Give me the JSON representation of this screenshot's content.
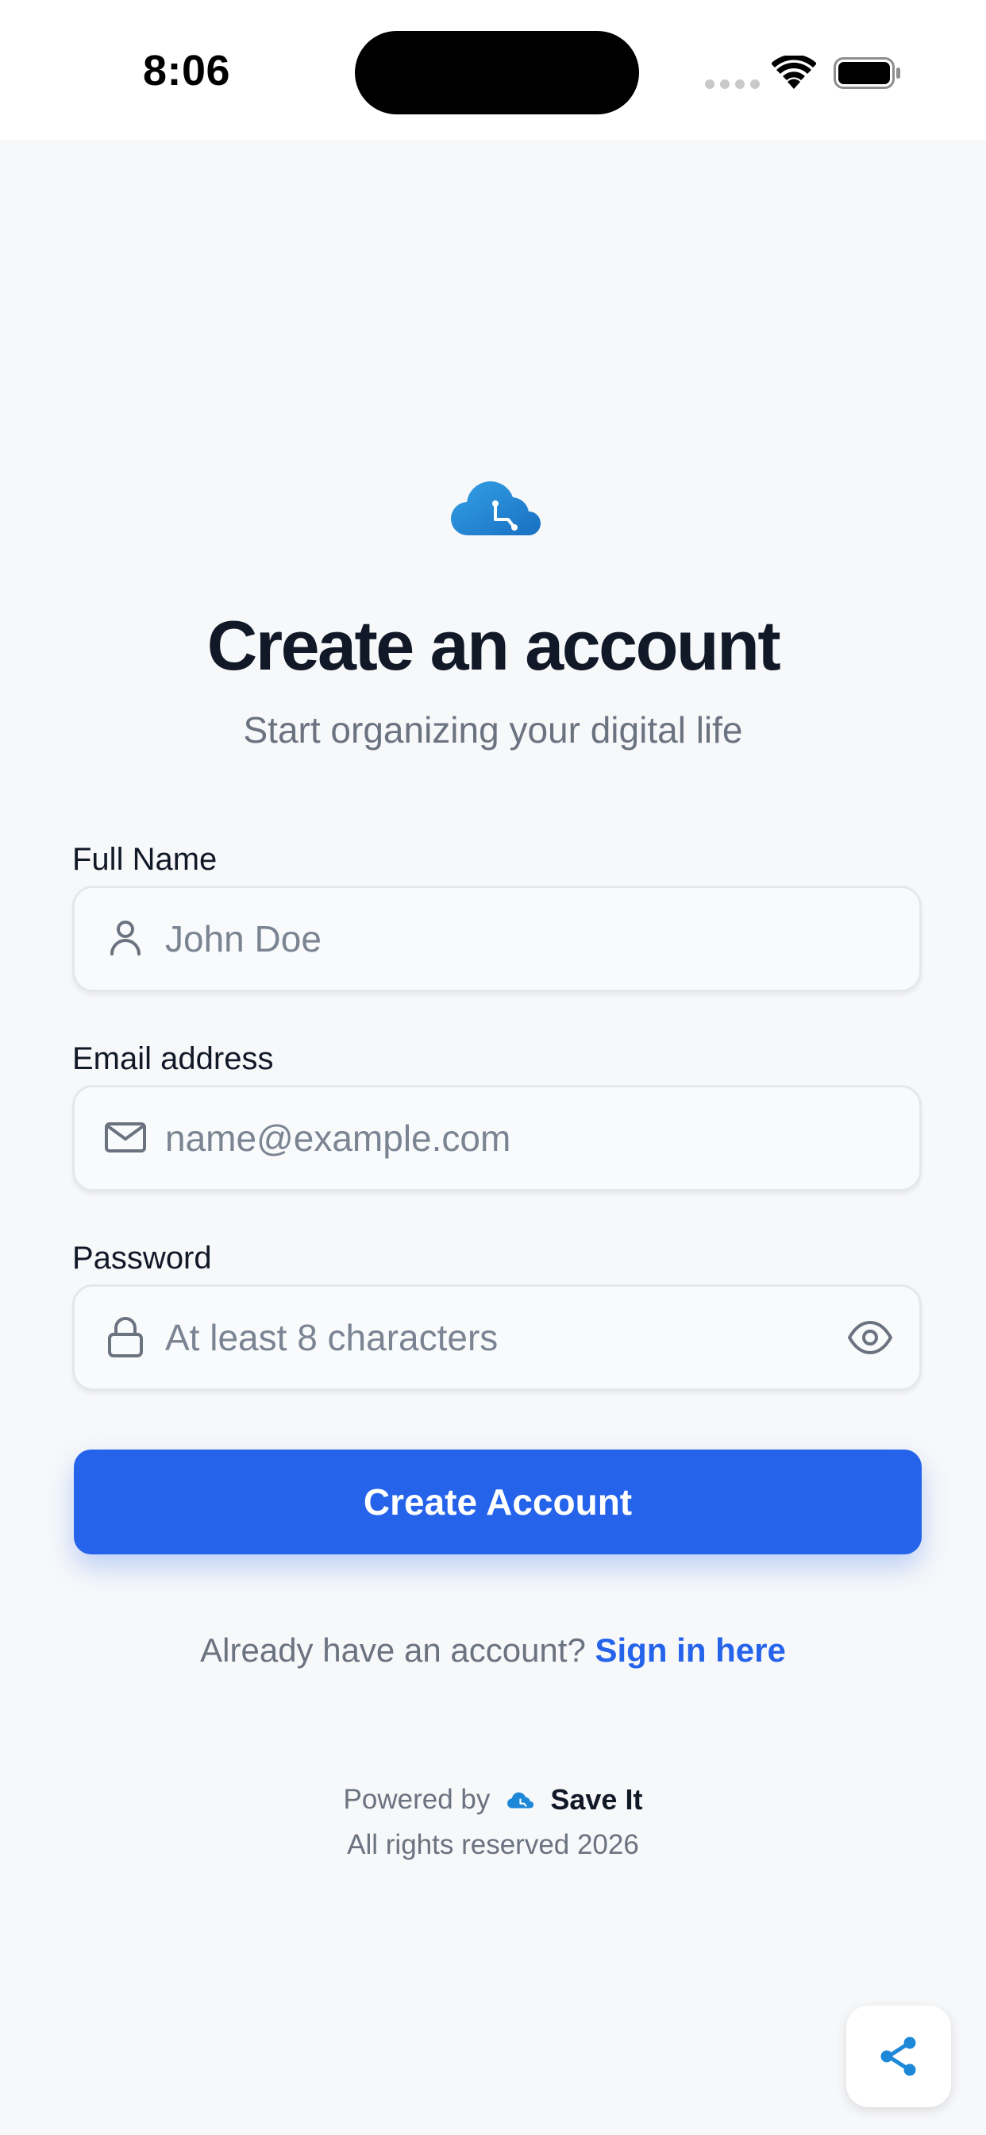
{
  "status_bar": {
    "time": "8:06"
  },
  "header": {
    "title": "Create an account",
    "subtitle": "Start organizing your digital life"
  },
  "form": {
    "full_name": {
      "label": "Full Name",
      "placeholder": "John Doe",
      "icon": "user-icon"
    },
    "email": {
      "label": "Email address",
      "placeholder": "name@example.com",
      "icon": "mail-icon"
    },
    "password": {
      "label": "Password",
      "placeholder": "At least 8 characters",
      "icon": "lock-icon",
      "toggle_icon": "eye-icon"
    },
    "submit_label": "Create Account"
  },
  "signin": {
    "prompt": "Already have an account?",
    "link_label": "Sign in here"
  },
  "footer": {
    "powered_by": "Powered by",
    "brand": "Save It",
    "rights": "All rights reserved 2026"
  },
  "colors": {
    "primary": "#2563eb",
    "title": "#111827",
    "muted": "#6b7280",
    "background": "#f7f8fa",
    "logo": "#1e88d8"
  }
}
